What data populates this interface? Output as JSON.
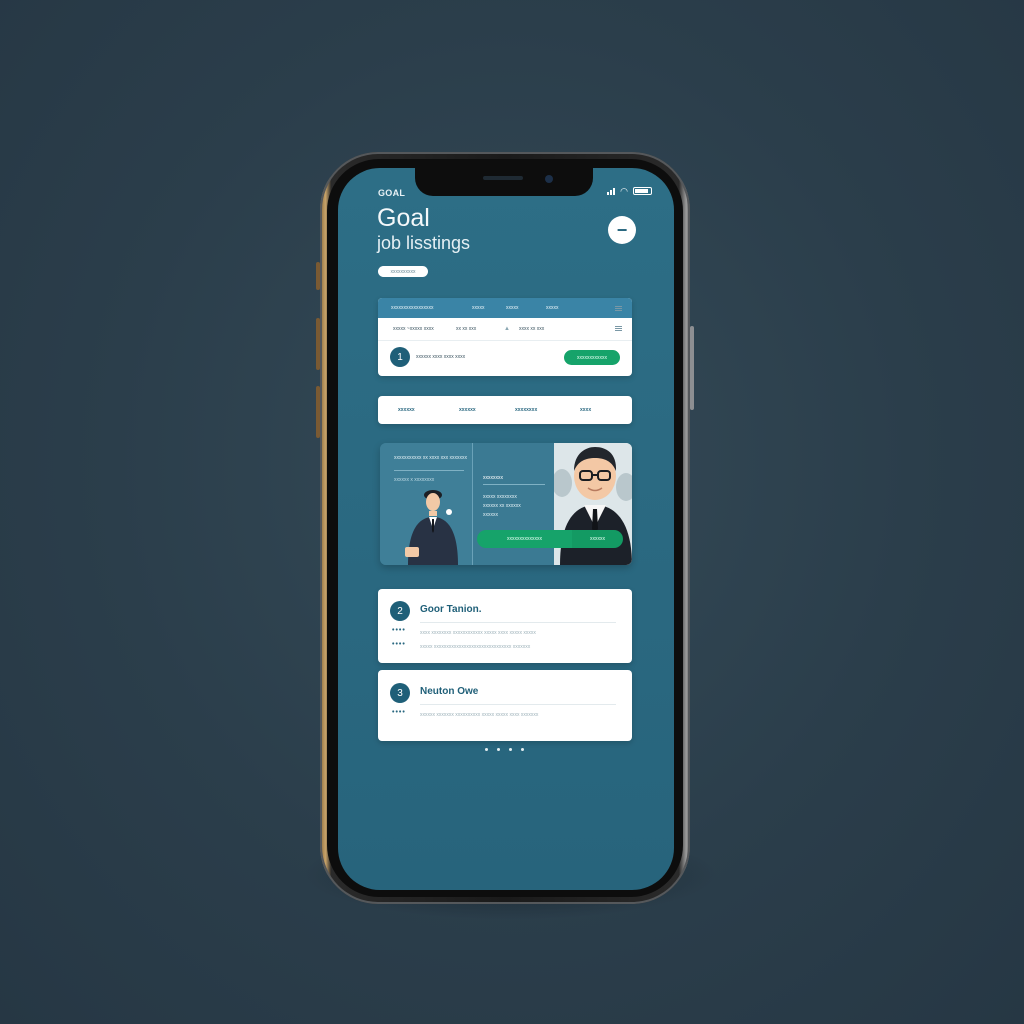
{
  "status_bar": {
    "carrier": "GOAL"
  },
  "header": {
    "title": "Goal",
    "subtitle": "job lisstings",
    "action_symbol": "−",
    "chip_label": "xxxxxxxxxx"
  },
  "table_card": {
    "columns": [
      "xxxxxxxxxxxxxxxxx",
      "xxxxx",
      "xxxxx",
      "xxxxx"
    ],
    "row_texts": [
      "xxxxx ~xxxxx xxxx",
      "xx xx xxx",
      "xxxx xx xxx"
    ],
    "badge_number": "1",
    "badge_text": "xxxxxx xxxx xxxx xxxx",
    "apply_button": "xxxxxxxxxxxx"
  },
  "filter_bar": {
    "filters": [
      "xxxxxx",
      "xxxxxx",
      "xxxxxxxx",
      "xxxx"
    ]
  },
  "hero_card": {
    "heading": "xxxxxxxxxxx xx xxxx xxx xxxxxxx",
    "left_caption": "xxxxxx x xxxxxxxx",
    "right_title": "xxxxxxxx",
    "right_lines": [
      "xxxxx xxxxxxxx",
      "xxxxxx xx xxxxxx",
      "xxxxxx"
    ],
    "cta_primary": "xxxxxxxxxxxxxx",
    "cta_secondary": "xxxxxx"
  },
  "list_items": [
    {
      "number": "2",
      "title": "Goor Tanion.",
      "meta": [
        "xxxx xxxxxxxx xxxxxxxxxxxx xxxxx xxxx xxxxx xxxxx",
        "xxxxx xxxxxxxxxxxxxxxxxxxxxxxxxxxxxxx xxxxxxx"
      ]
    },
    {
      "number": "3",
      "title": "Neuton Owe",
      "meta": [
        "xxxxxx xxxxxxx  xxxxxxxxxx xxxxx xxxxx xxxx xxxxxxx"
      ]
    }
  ],
  "colors": {
    "screen_bg": "#2a6880",
    "accent_green": "#16a36a",
    "badge_blue": "#1f5f78",
    "table_header": "#3a84a6"
  }
}
